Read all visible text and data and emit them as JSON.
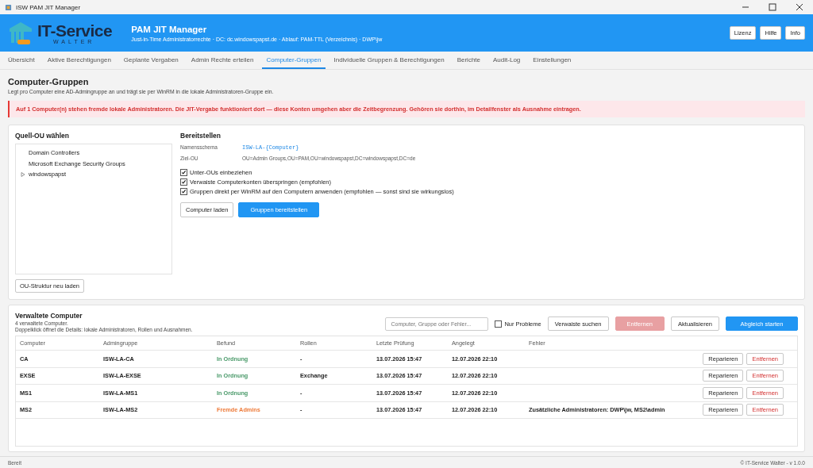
{
  "window": {
    "title": "ISW PAM JIT Manager"
  },
  "header": {
    "logo_name": "IT-Service",
    "logo_sub": "WALTER",
    "app_title": "PAM JIT Manager",
    "subtitle": "Just-in-Time Administratorrechte  ·  DC: dc.windowspapst.de  ·  Ablauf: PAM-TTL (Verzeichnis)  ·  DWP\\jw",
    "buttons": [
      "Lizenz",
      "Hilfe",
      "Info"
    ]
  },
  "tabs": [
    {
      "label": "Übersicht",
      "selected": false
    },
    {
      "label": "Aktive Berechtigungen",
      "selected": false
    },
    {
      "label": "Geplante Vergaben",
      "selected": false
    },
    {
      "label": "Admin Rechte erteilen",
      "selected": false
    },
    {
      "label": "Computer-Gruppen",
      "selected": true
    },
    {
      "label": "Individuelle Gruppen & Berechtigungen",
      "selected": false
    },
    {
      "label": "Berichte",
      "selected": false
    },
    {
      "label": "Audit-Log",
      "selected": false
    },
    {
      "label": "Einstellungen",
      "selected": false
    }
  ],
  "page": {
    "title": "Computer-Gruppen",
    "description": "Legt pro Computer eine AD-Admingruppe an und trägt sie per WinRM in die lokale Administratoren-Gruppe ein.",
    "alert": "Auf 1 Computer(n) stehen fremde lokale Administratoren. Die JIT-Vergabe funktioniert dort — diese Konten umgehen aber die Zeitbegrenzung. Gehören sie dorthin, im Detailfenster als Ausnahme eintragen."
  },
  "source_ou": {
    "title": "Quell-OU wählen",
    "tree": [
      {
        "label": "Domain Controllers"
      },
      {
        "label": "Microsoft Exchange Security Groups"
      },
      {
        "label": "windowspapst",
        "expanded": false
      }
    ],
    "reload_button": "OU-Struktur neu laden"
  },
  "provision": {
    "title": "Bereitstellen",
    "fields": [
      {
        "label": "Namensschema",
        "value": "ISW-LA-{Computer}",
        "kind": "code"
      },
      {
        "label": "Ziel-OU",
        "value": "OU=Admin Groups,OU=PAM,OU=windowspapst,DC=windowspapst,DC=de",
        "kind": "text"
      }
    ],
    "options": [
      {
        "label": "Unter-OUs einbeziehen",
        "checked": true
      },
      {
        "label": "Verwaiste Computerkonten überspringen (empfohlen)",
        "checked": true
      },
      {
        "label": "Gruppen direkt per WinRM auf den Computern anwenden (empfohlen — sonst sind sie wirkungslos)",
        "checked": true
      }
    ],
    "buttons": [
      {
        "label": "Computer laden",
        "kind": "secondary"
      },
      {
        "label": "Gruppen bereitstellen",
        "kind": "primary"
      }
    ]
  },
  "managed": {
    "title": "Verwaltete Computer",
    "count": "4 verwaltete Computer.",
    "hint": "Doppelklick öffnet die Details: lokale Administratoren, Rollen und Ausnahmen.",
    "search": {
      "placeholder": "Computer, Gruppe oder Fehler..."
    },
    "only_problems": {
      "label": "Nur Probleme",
      "checked": false
    },
    "buttons": [
      {
        "label": "Verwaiste suchen",
        "kind": "secondary",
        "disabled": false
      },
      {
        "label": "Entfernen",
        "kind": "danger",
        "disabled": true
      },
      {
        "label": "Aktualisieren",
        "kind": "secondary",
        "disabled": false
      },
      {
        "label": "Abgleich starten",
        "kind": "primary",
        "disabled": false
      }
    ],
    "table": {
      "columns": [
        "Computer",
        "Admingruppe",
        "Befund",
        "Rollen",
        "Letzte Prüfung",
        "Angelegt",
        "Fehler"
      ],
      "rows": [
        {
          "computer": "CA",
          "group": "ISW-LA-CA",
          "finding": "In Ordnung",
          "color": "#4a9a6a",
          "roles": "-",
          "checked": "13.07.2026 15:47",
          "created": "12.07.2026 22:10",
          "error": "",
          "actions": [
            "Reparieren",
            "Entfernen"
          ]
        },
        {
          "computer": "EXSE",
          "group": "ISW-LA-EXSE",
          "finding": "In Ordnung",
          "color": "#4a9a6a",
          "roles": "Exchange",
          "checked": "13.07.2026 15:47",
          "created": "12.07.2026 22:10",
          "error": "",
          "actions": [
            "Reparieren",
            "Entfernen"
          ]
        },
        {
          "computer": "MS1",
          "group": "ISW-LA-MS1",
          "finding": "In Ordnung",
          "color": "#4a9a6a",
          "roles": "-",
          "checked": "13.07.2026 15:47",
          "created": "12.07.2026 22:10",
          "error": "",
          "actions": [
            "Reparieren",
            "Entfernen"
          ]
        },
        {
          "computer": "MS2",
          "group": "ISW-LA-MS2",
          "finding": "Fremde Admins",
          "color": "#ee7b3a",
          "roles": "-",
          "checked": "13.07.2026 15:47",
          "created": "12.07.2026 22:10",
          "error": "Zusätzliche Administratoren: DWP\\jw, MS2\\admin",
          "actions": [
            "Reparieren",
            "Entfernen"
          ]
        }
      ]
    }
  },
  "status_bar": {
    "left": "Bereit",
    "right": "© IT-Service Walter  - v 1.0.0"
  }
}
